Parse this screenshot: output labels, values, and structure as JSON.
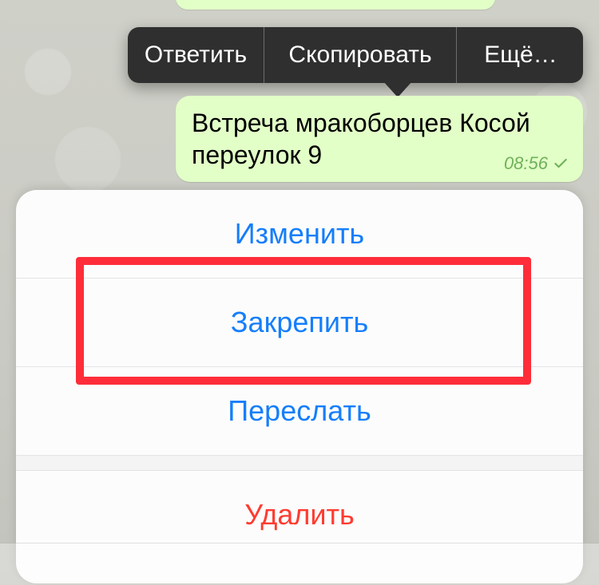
{
  "popover": {
    "reply": "Ответить",
    "copy": "Скопировать",
    "more": "Ещё…"
  },
  "message": {
    "text": "Встреча мракоборцев Косой переулок 9",
    "time": "08:56"
  },
  "sheet": {
    "edit": "Изменить",
    "pin": "Закрепить",
    "forward": "Переслать",
    "delete": "Удалить"
  }
}
